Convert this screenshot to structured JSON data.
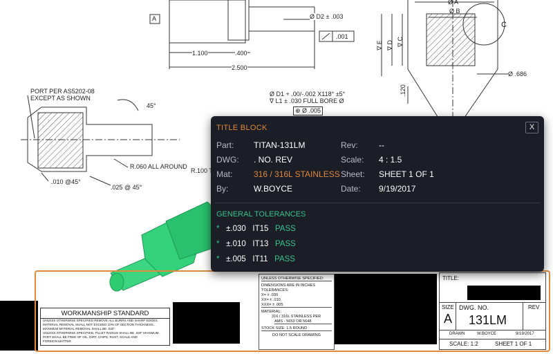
{
  "drawing": {
    "dims": {
      "d_1100": "1.100",
      "d_400": ".400",
      "d_2500": "2.500",
      "d2": "Ø D2 ± .003",
      "d2_tol": ".001",
      "datum_a": "A",
      "phi_a": "Ø A",
      "phi_b": "Ø B",
      "c": "C",
      "e": "∇ E",
      "d": "∇ D",
      "vc": "∇ C",
      "d686": "Ø .686",
      "d120": ".120",
      "port": "PORT PER AS5202-08",
      "except": "EXCEPT AS SHOWN",
      "a45": "45°",
      "d1": "Ø D1 + .00/-.002 X118° ±5°",
      "l1": "∇ L1 ± .030 FULL BORE Ø",
      "pos": "⊕ Ø .005",
      "r060": "R.060 ALL AROUND",
      "r100": "R.100 T",
      "d010": ".010 @45°",
      "d025": ".025 @ 45°"
    },
    "workmanship": {
      "title": "WORKMANSHIP STANDARD",
      "lines": [
        "UNLESS OTHERWISE SPECIFIED REMOVE ALL BURRS AND SHARP EDGES.",
        "MATERIAL REMOVAL SHALL NOT EXCEED 10% OF SECTION THICKNESS.",
        "MAXIMUM MATERIAL REMOVAL SHALL BE .020\".",
        "UNLESS OTHERWISE SPECIFIED, FILLET RADIUS SHALL BE .020\" MAXIMUM.",
        "PART SHALL BE FREE OF OIL, DIRT, CHIPS, RUST, SCALE AND",
        "FOREIGN MATTER"
      ]
    },
    "notes": {
      "unless": "UNLESS OTHERWISE SPECIFIED:",
      "dims_inches": "DIMENSIONS ARE IN INCHES",
      "tolerances": "TOLERANCES:",
      "x": "X= ± .030",
      "xx": "XX= ± .010",
      "xxx": "XXX= ± .005",
      "material_label": "MATERIAL:",
      "material_1": "316 / 316L STAINLESS PER",
      "material_2": "AMS - 5653 OR 5648",
      "stock": "STOCK SIZE:   1.5 ROUND",
      "noscale": "DO NOT SCALE DRAWING"
    },
    "titleblock": {
      "title_label": "TITLE:",
      "size_label": "SIZE",
      "size_value": "A",
      "dwg_label": "DWG.  NO.",
      "dwg_value": "131LM",
      "rev_label": "REV",
      "drawn_label": "DRAWN",
      "drawn_value": "W.BOYCE",
      "drawn_date": "9/19/2017",
      "scale": "SCALE: 1:2",
      "sheet": "SHEET 1 OF 1"
    }
  },
  "panel": {
    "title": "TITLE BLOCK",
    "close": "X",
    "rows": {
      "part_label": "Part:",
      "part_value": "TITAN-131LM",
      "rev_label": "Rev:",
      "rev_value": "--",
      "dwg_label": "DWG:",
      "dwg_value": ". NO. REV",
      "scale_label": "Scale:",
      "scale_value": "4 : 1.5",
      "mat_label": "Mat:",
      "mat_value": "316 / 316L STAINLESS",
      "sheet_label": "Sheet:",
      "sheet_value": "SHEET 1 OF 1",
      "by_label": "By:",
      "by_value": "W.BOYCE",
      "date_label": "Date:",
      "date_value": "9/19/2017"
    },
    "tolerances_title": "GENERAL TOLERANCES",
    "tolerances": [
      {
        "bullet": "*",
        "value": "±.030",
        "grade": "IT15",
        "status": "PASS"
      },
      {
        "bullet": "*",
        "value": "±.010",
        "grade": "IT13",
        "status": "PASS"
      },
      {
        "bullet": "*",
        "value": "±.005",
        "grade": "IT11",
        "status": "PASS"
      }
    ]
  },
  "colors": {
    "accent": "#e08a3c",
    "pass": "#35c48a",
    "panel_bg": "#1b1d27",
    "part_green": "#2ecc71"
  }
}
